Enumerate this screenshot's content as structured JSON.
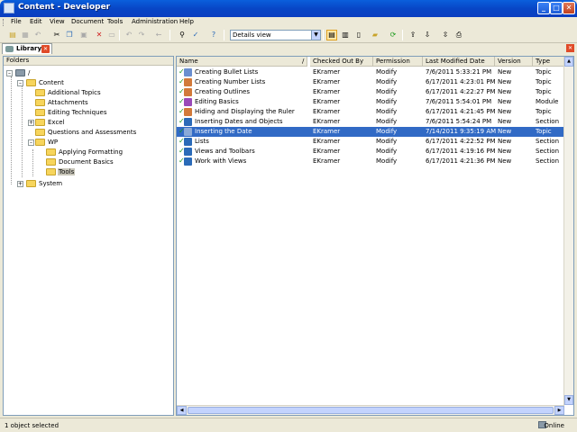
{
  "window": {
    "title": "Content - Developer",
    "controls": {
      "minimize": "_",
      "maximize": "□",
      "close": "✕"
    }
  },
  "menu": [
    "File",
    "Edit",
    "View",
    "Document",
    "Tools",
    "Administration",
    "Help"
  ],
  "toolbar": {
    "view_select": "Details view",
    "icons": [
      "new-icon",
      "save-icon",
      "cut-icon",
      "copy-icon",
      "paste-icon",
      "delete-icon",
      "undo-icon",
      "redo-icon",
      "find-icon",
      "spell-check-icon",
      "help-icon",
      "details-view-icon",
      "split-view-icon",
      "columns-view-icon",
      "refresh-icon",
      "check-in-icon",
      "check-out-icon"
    ]
  },
  "tab": {
    "label": "Library"
  },
  "folders": {
    "header": "Folders",
    "root": "/",
    "items": [
      {
        "label": "Content",
        "level": 1,
        "expanded": true
      },
      {
        "label": "Additional Topics",
        "level": 2
      },
      {
        "label": "Attachments",
        "level": 2
      },
      {
        "label": "Editing Techniques",
        "level": 2
      },
      {
        "label": "Excel",
        "level": 2,
        "expandable": true
      },
      {
        "label": "Questions and Assessments",
        "level": 2
      },
      {
        "label": "WP",
        "level": 2,
        "expanded": true
      },
      {
        "label": "Applying Formatting",
        "level": 3
      },
      {
        "label": "Document Basics",
        "level": 3
      },
      {
        "label": "Tools",
        "level": 3,
        "selected": true
      },
      {
        "label": "System",
        "level": 1,
        "expandable": true
      }
    ]
  },
  "list": {
    "columns": [
      "Name",
      "/",
      "Checked Out By",
      "Permission",
      "Last Modified Date",
      "Version",
      "Type"
    ],
    "rows": [
      {
        "name": "Creating Bullet Lists",
        "checked_out_by": "EKramer",
        "permission": "Modify",
        "modified": "7/6/2011 5:33:21 PM",
        "version": "New",
        "type": "Topic",
        "icon_color": "#6a8fd0"
      },
      {
        "name": "Creating Number Lists",
        "checked_out_by": "EKramer",
        "permission": "Modify",
        "modified": "6/17/2011 4:23:01 PM",
        "version": "New",
        "type": "Topic",
        "icon_color": "#d27a3a"
      },
      {
        "name": "Creating Outlines",
        "checked_out_by": "EKramer",
        "permission": "Modify",
        "modified": "6/17/2011 4:22:27 PM",
        "version": "New",
        "type": "Topic",
        "icon_color": "#d27a3a"
      },
      {
        "name": "Editing Basics",
        "checked_out_by": "EKramer",
        "permission": "Modify",
        "modified": "7/6/2011 5:54:01 PM",
        "version": "New",
        "type": "Module",
        "icon_color": "#9a4ab8"
      },
      {
        "name": "Hiding and Displaying the Ruler",
        "checked_out_by": "EKramer",
        "permission": "Modify",
        "modified": "6/17/2011 4:21:45 PM",
        "version": "New",
        "type": "Topic",
        "icon_color": "#d27a3a"
      },
      {
        "name": "Inserting Dates and Objects",
        "checked_out_by": "EKramer",
        "permission": "Modify",
        "modified": "7/6/2011 5:54:24 PM",
        "version": "New",
        "type": "Section",
        "icon_color": "#2a6ab8"
      },
      {
        "name": "Inserting the Date",
        "checked_out_by": "EKramer",
        "permission": "Modify",
        "modified": "7/14/2011 9:35:19 AM",
        "version": "New",
        "type": "Topic",
        "icon_color": "#8aaad8",
        "selected": true
      },
      {
        "name": "Lists",
        "checked_out_by": "EKramer",
        "permission": "Modify",
        "modified": "6/17/2011 4:22:52 PM",
        "version": "New",
        "type": "Section",
        "icon_color": "#2a6ab8"
      },
      {
        "name": "Views and Toolbars",
        "checked_out_by": "EKramer",
        "permission": "Modify",
        "modified": "6/17/2011 4:19:16 PM",
        "version": "New",
        "type": "Section",
        "icon_color": "#2a6ab8"
      },
      {
        "name": "Work with Views",
        "checked_out_by": "EKramer",
        "permission": "Modify",
        "modified": "6/17/2011 4:21:36 PM",
        "version": "New",
        "type": "Section",
        "icon_color": "#2a6ab8"
      }
    ]
  },
  "status": {
    "message": "1 object selected",
    "connection": "Online"
  }
}
